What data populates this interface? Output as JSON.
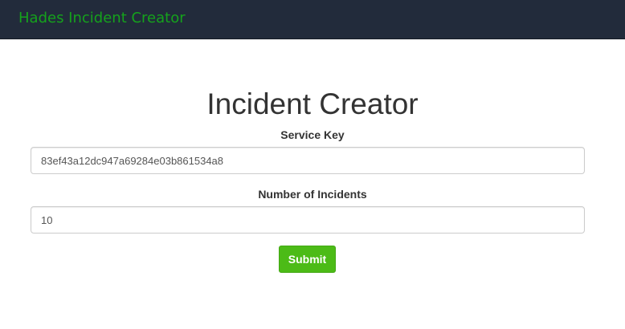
{
  "navbar": {
    "brand": "Hades Incident Creator",
    "brand_color": "#15a21c",
    "background": "#222b3b"
  },
  "form": {
    "title": "Incident Creator",
    "service_key": {
      "label": "Service Key",
      "value": "83ef43a12dc947a69284e03b861534a8"
    },
    "incident_count": {
      "label": "Number of Incidents",
      "value": "10"
    },
    "submit_label": "Submit",
    "submit_color": "#4cbb17"
  }
}
